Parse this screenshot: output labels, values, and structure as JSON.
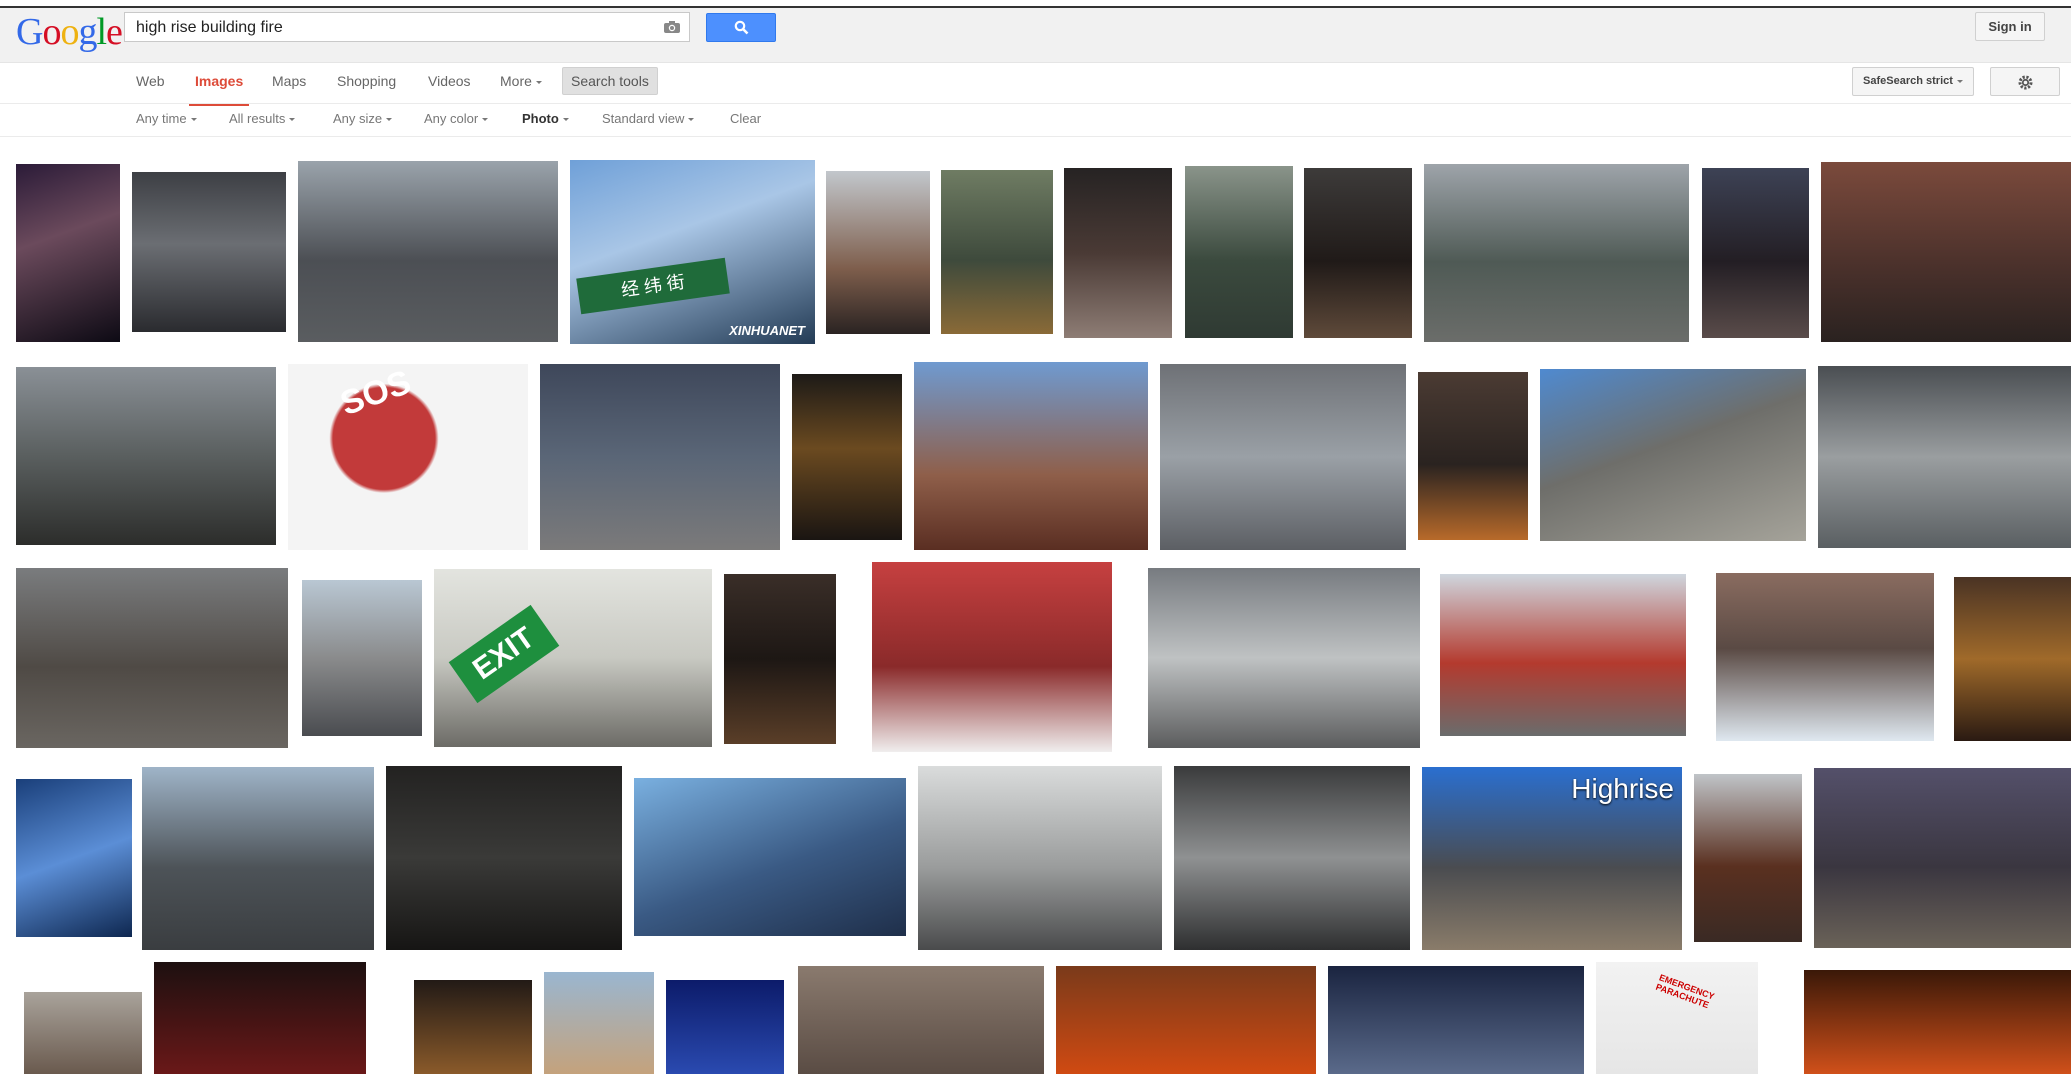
{
  "header": {
    "logo_letters": [
      {
        "ch": "G",
        "color": "#3369e8"
      },
      {
        "ch": "o",
        "color": "#d50f25"
      },
      {
        "ch": "o",
        "color": "#eeb211"
      },
      {
        "ch": "g",
        "color": "#3369e8"
      },
      {
        "ch": "l",
        "color": "#009925"
      },
      {
        "ch": "e",
        "color": "#d50f25"
      }
    ],
    "query": "high rise building fire",
    "sign_in": "Sign in"
  },
  "nav": {
    "tabs": [
      "Web",
      "Images",
      "Maps",
      "Shopping",
      "Videos",
      "More"
    ],
    "active": "Images",
    "search_tools": "Search tools",
    "safesearch": "SafeSearch strict"
  },
  "tools": {
    "filters": [
      "Any time",
      "All results",
      "Any size",
      "Any color",
      "Photo",
      "Standard view"
    ],
    "selected_filter": "Photo",
    "clear": "Clear"
  },
  "accent": "#dd4b39",
  "search_button_color": "#4d90fe",
  "overlay_texts": {
    "xinhua_sign": "经 纬 街",
    "xinhua_watermark": "XINHUANET",
    "sos": "SOS",
    "exit": "EXIT",
    "highrise": "Highrise",
    "emergency": "EMERGENCY PARACHUTE"
  }
}
